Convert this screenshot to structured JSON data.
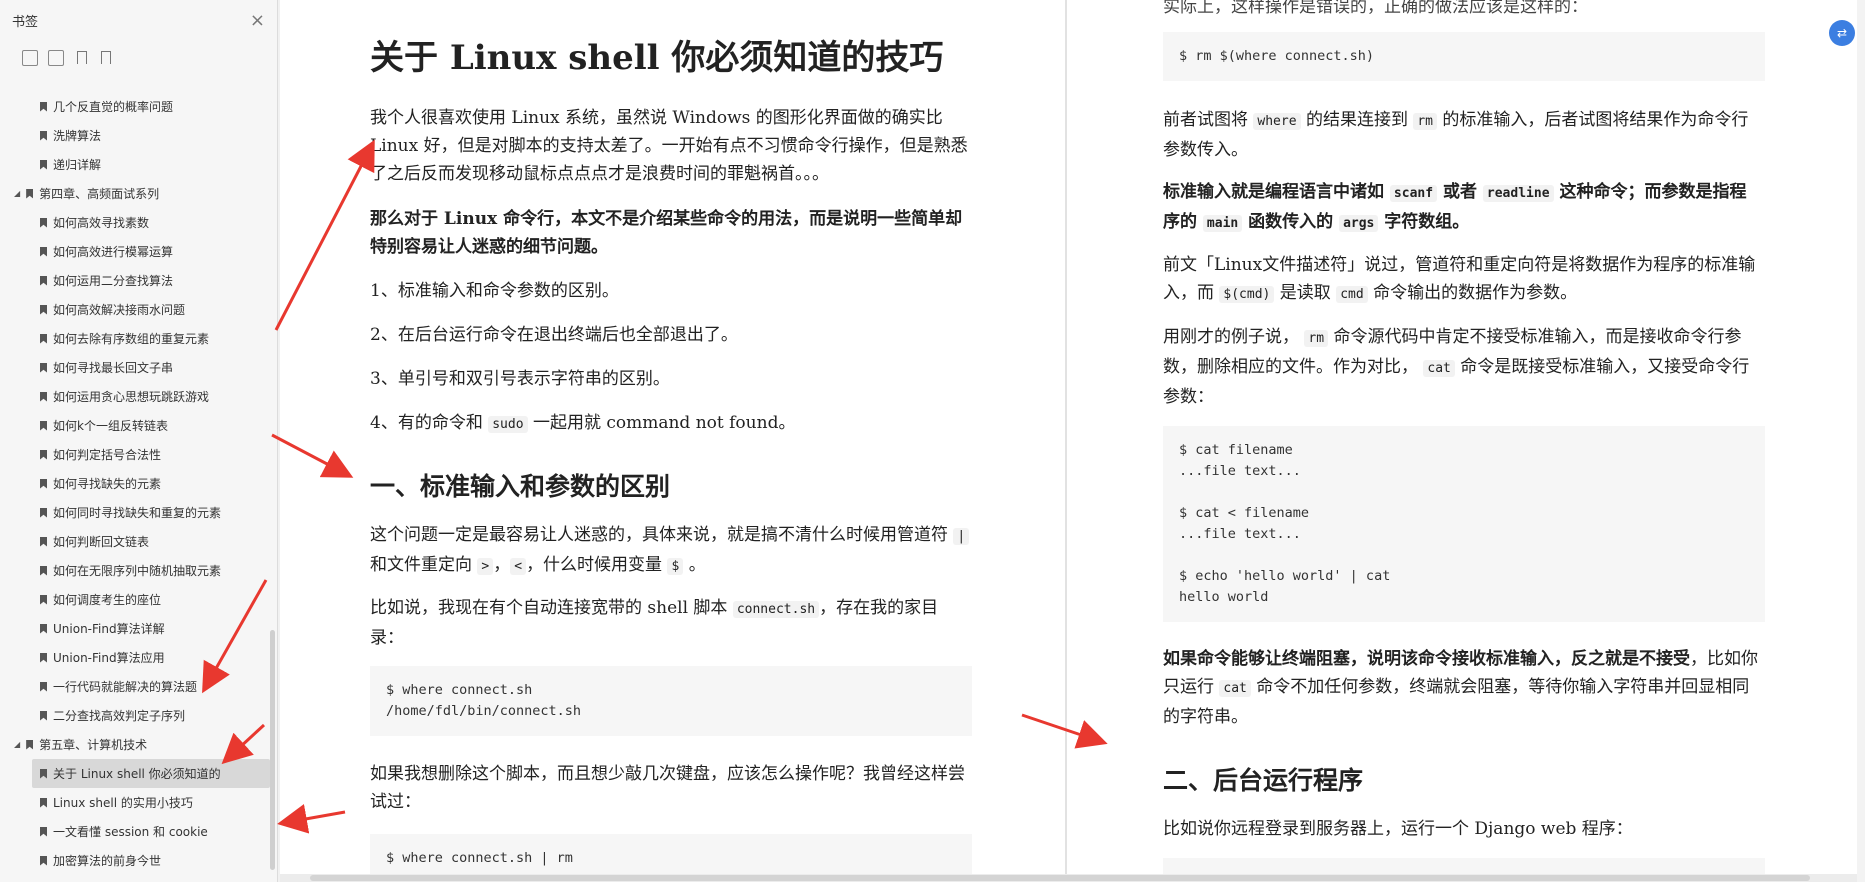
{
  "sidebar": {
    "title": "书签",
    "close": "×",
    "items": [
      {
        "level": 2,
        "label": "几个反直觉的概率问题"
      },
      {
        "level": 2,
        "label": "洗牌算法"
      },
      {
        "level": 2,
        "label": "递归详解"
      },
      {
        "level": 1,
        "label": "第四章、高频面试系列"
      },
      {
        "level": 2,
        "label": "如何高效寻找素数"
      },
      {
        "level": 2,
        "label": "如何高效进行模幂运算"
      },
      {
        "level": 2,
        "label": "如何运用二分查找算法"
      },
      {
        "level": 2,
        "label": "如何高效解决接雨水问题"
      },
      {
        "level": 2,
        "label": "如何去除有序数组的重复元素"
      },
      {
        "level": 2,
        "label": "如何寻找最长回文子串"
      },
      {
        "level": 2,
        "label": "如何运用贪心思想玩跳跃游戏"
      },
      {
        "level": 2,
        "label": "如何k个一组反转链表"
      },
      {
        "level": 2,
        "label": "如何判定括号合法性"
      },
      {
        "level": 2,
        "label": "如何寻找缺失的元素"
      },
      {
        "level": 2,
        "label": "如何同时寻找缺失和重复的元素"
      },
      {
        "level": 2,
        "label": "如何判断回文链表"
      },
      {
        "level": 2,
        "label": "如何在无限序列中随机抽取元素"
      },
      {
        "level": 2,
        "label": "如何调度考生的座位"
      },
      {
        "level": 2,
        "label": "Union-Find算法详解"
      },
      {
        "level": 2,
        "label": "Union-Find算法应用"
      },
      {
        "level": 2,
        "label": "一行代码就能解决的算法题"
      },
      {
        "level": 2,
        "label": "二分查找高效判定子序列"
      },
      {
        "level": 1,
        "label": "第五章、计算机技术"
      },
      {
        "level": 2,
        "label": "关于 Linux shell 你必须知道的",
        "active": true
      },
      {
        "level": 2,
        "label": "Linux shell 的实用小技巧"
      },
      {
        "level": 2,
        "label": "一文看懂 session 和 cookie"
      },
      {
        "level": 2,
        "label": "加密算法的前身今世"
      }
    ]
  },
  "page1": {
    "title": "关于 Linux shell 你必须知道的技巧",
    "intro": "我个人很喜欢使用 Linux 系统，虽然说 Windows 的图形化界面做的确实比 Linux 好，但是对脚本的支持太差了。一开始有点不习惯命令行操作，但是熟悉了之后反而发现移动鼠标点点点才是浪费时间的罪魁祸首。。。",
    "bold_intro": "那么对于 Linux 命令行，本文不是介绍某些命令的用法，而是说明一些简单却特别容易让人迷惑的细节问题。",
    "list": [
      "1、标准输入和命令参数的区别。",
      "2、在后台运行命令在退出终端后也全部退出了。",
      "3、单引号和双引号表示字符串的区别。"
    ],
    "list4_a": "4、有的命令和 ",
    "list4_code": "sudo",
    "list4_b": " 一起用就 command not found。",
    "h2": "一、标准输入和参数的区别",
    "p1_a": "这个问题一定是最容易让人迷惑的，具体来说，就是搞不清什么时候用管道符 ",
    "p1_c1": "|",
    "p1_b": " 和文件重定向 ",
    "p1_c2": ">",
    "p1_c": "，",
    "p1_c3": "<",
    "p1_d": "，什么时候用变量 ",
    "p1_c4": "$",
    "p1_e": " 。",
    "p2_a": "比如说，我现在有个自动连接宽带的 shell 脚本 ",
    "p2_code": "connect.sh",
    "p2_b": "，存在我的家目录：",
    "code1": "$ where connect.sh\n/home/fdl/bin/connect.sh",
    "p3": "如果我想删除这个脚本，而且想少敲几次键盘，应该怎么操作呢？我曾经这样尝试过：",
    "code2": "$ where connect.sh | rm"
  },
  "page2": {
    "cut_top": "实际上，这样操作是错误的，正确的做法应该是这样的：",
    "code1": "$ rm $(where connect.sh)",
    "p1_a": "前者试图将 ",
    "p1_c1": "where",
    "p1_b": " 的结果连接到 ",
    "p1_c2": "rm",
    "p1_c": " 的标准输入，后者试图将结果作为命令行参数传入。",
    "p2_a": "标准输入就是编程语言中诸如 ",
    "p2_c1": "scanf",
    "p2_b": " 或者 ",
    "p2_c2": "readline",
    "p2_c": " 这种命令；而参数是指程序的 ",
    "p2_c3": "main",
    "p2_d": " 函数传入的 ",
    "p2_c4": "args",
    "p2_e": " 字符数组。",
    "p3_a": "前文「Linux文件描述符」说过，管道符和重定向符是将数据作为程序的标准输入，而 ",
    "p3_c1": "$(cmd)",
    "p3_b": " 是读取 ",
    "p3_c2": "cmd",
    "p3_c": " 命令输出的数据作为参数。",
    "p4_a": "用刚才的例子说， ",
    "p4_c1": "rm",
    "p4_b": " 命令源代码中肯定不接受标准输入，而是接收命令行参数，删除相应的文件。作为对比， ",
    "p4_c2": "cat",
    "p4_c": " 命令是既接受标准输入，又接受命令行参数：",
    "code2": "$ cat filename\n...file text...\n\n$ cat < filename\n...file text...\n\n$ echo 'hello world' | cat\nhello world",
    "p5_bold": "如果命令能够让终端阻塞，说明该命令接收标准输入，反之就是不接受",
    "p5_a": "，比如你只运行 ",
    "p5_c1": "cat",
    "p5_b": " 命令不加任何参数，终端就会阻塞，等待你输入字符串并回显相同的字符串。",
    "h2": "二、后台运行程序",
    "p6": "比如说你远程登录到服务器上，运行一个 Django web 程序："
  },
  "colors": {
    "arrow": "#e8382f",
    "accent": "#3b7ee1"
  }
}
